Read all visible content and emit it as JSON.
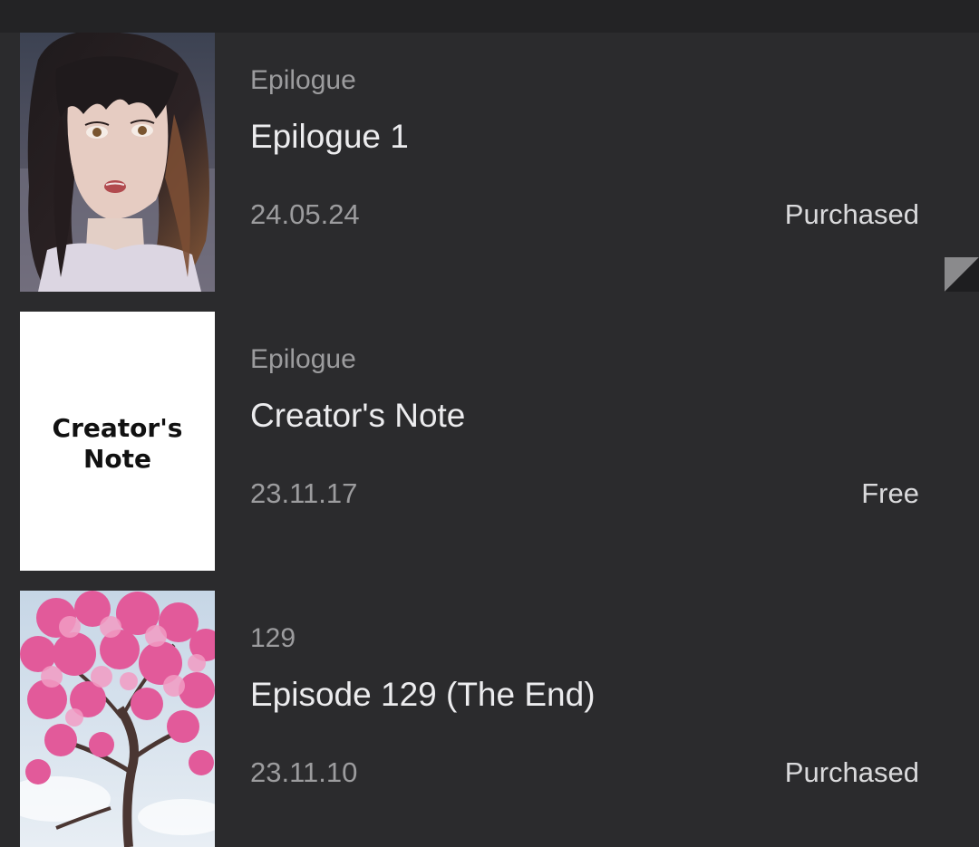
{
  "episodes": [
    {
      "subtitle": "Epilogue",
      "title": "Epilogue 1",
      "date": "24.05.24",
      "status": "Purchased",
      "thumbnail": "girl-portrait-thumbnail"
    },
    {
      "subtitle": "Epilogue",
      "title": "Creator's Note",
      "date": "23.11.17",
      "status": "Free",
      "thumbnail": "creators-note-thumbnail",
      "thumbnail_text_line1": "Creator's",
      "thumbnail_text_line2": "Note"
    },
    {
      "subtitle": "129",
      "title": "Episode 129 (The End)",
      "date": "23.11.10",
      "status": "Purchased",
      "thumbnail": "cherry-blossom-thumbnail"
    }
  ],
  "colors": {
    "background": "#2b2b2d",
    "topbar": "#232325",
    "subtitle": "#9c9c9e",
    "title": "#ececee",
    "status": "#dadadc"
  },
  "icons": {
    "fold_corner": "page-fold-icon"
  }
}
